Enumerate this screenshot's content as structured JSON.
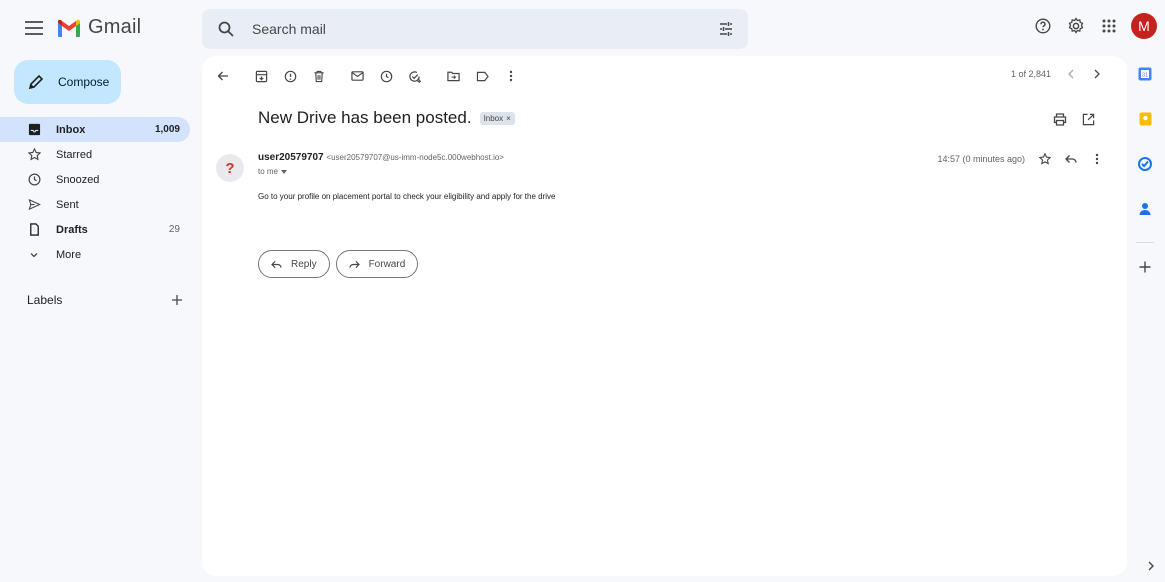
{
  "header": {
    "app_name": "Gmail",
    "search_placeholder": "Search mail",
    "avatar_letter": "M"
  },
  "sidebar": {
    "compose_label": "Compose",
    "items": [
      {
        "label": "Inbox",
        "count": "1,009",
        "icon": "inbox-icon",
        "active": true
      },
      {
        "label": "Starred",
        "count": "",
        "icon": "star-icon"
      },
      {
        "label": "Snoozed",
        "count": "",
        "icon": "clock-icon"
      },
      {
        "label": "Sent",
        "count": "",
        "icon": "send-icon"
      },
      {
        "label": "Drafts",
        "count": "29",
        "icon": "draft-icon",
        "bold": true
      },
      {
        "label": "More",
        "count": "",
        "icon": "chevron-down-icon"
      }
    ],
    "labels_heading": "Labels"
  },
  "toolbar": {
    "pager_text": "1 of 2,841"
  },
  "message": {
    "subject": "New Drive has been posted.",
    "label_chip": "Inbox",
    "sender_name": "user20579707",
    "sender_email": "<user20579707@us-imm-node5c.000webhost.io>",
    "recipient": "to me",
    "time": "14:57 (0 minutes ago)",
    "body": "Go to your profile on placement portal to check your eligibility and apply for the drive",
    "avatar_glyph": "?"
  },
  "actions": {
    "reply_label": "Reply",
    "forward_label": "Forward"
  },
  "colors": {
    "background": "#f6f8fc",
    "compose": "#c2e7ff",
    "active_nav": "#d3e3fd",
    "search": "#e9eef6",
    "avatar": "#c5221f"
  }
}
